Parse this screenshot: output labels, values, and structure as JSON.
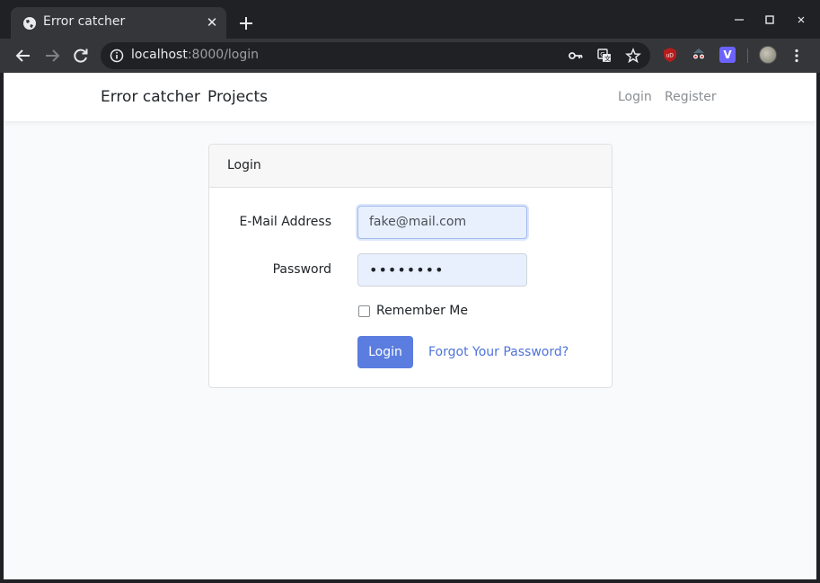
{
  "browser": {
    "tab": {
      "title": "Error catcher",
      "favicon": "globe-icon"
    },
    "url": {
      "host": "localhost",
      "rest": ":8000/login"
    },
    "icons": {
      "info": "info-icon",
      "password_key": "key-icon",
      "translate": "translate-icon",
      "bookmark": "star-icon",
      "extension_1": "ublock-icon",
      "extension_2": "spy-glasses-icon",
      "extension_3": "v-extension-icon",
      "extension_3_letter": "V"
    }
  },
  "navbar": {
    "brand": "Error catcher",
    "projects": "Projects",
    "login": "Login",
    "register": "Register"
  },
  "login_card": {
    "title": "Login",
    "email_label": "E-Mail Address",
    "email_value": "fake@mail.com",
    "password_label": "Password",
    "password_value": "••••••••",
    "remember_label": "Remember Me",
    "remember_checked": false,
    "submit_label": "Login",
    "forgot_label": "Forgot Your Password?"
  },
  "colors": {
    "primary": "#5a7ddf",
    "link": "#4f73d9",
    "page_background": "#f8fafc",
    "chrome_dark": "#202124",
    "chrome_toolbar": "#35363a"
  }
}
